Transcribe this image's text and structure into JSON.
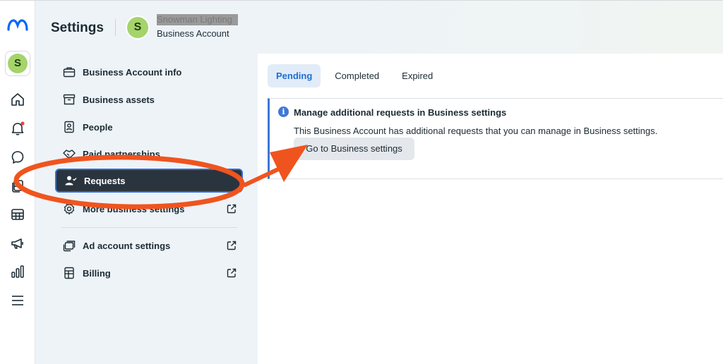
{
  "rail": {
    "avatar_letter": "S",
    "icons": [
      "meta-logo-icon",
      "home-icon",
      "bell-icon",
      "chat-icon",
      "pages-icon",
      "table-icon",
      "megaphone-icon",
      "bar-chart-icon",
      "menu-icon"
    ],
    "notification_dot_color": "#e4473e"
  },
  "header": {
    "title": "Settings",
    "account_avatar_letter": "S",
    "account_name": "Snowman Lighting",
    "account_type": "Business Account"
  },
  "sidebar": {
    "items": [
      {
        "label": "Business Account info",
        "icon": "briefcase-icon"
      },
      {
        "label": "Business assets",
        "icon": "archive-icon"
      },
      {
        "label": "People",
        "icon": "person-badge-icon"
      },
      {
        "label": "Paid partnerships",
        "icon": "handshake-icon"
      },
      {
        "label": "Requests",
        "icon": "person-check-icon",
        "active": true
      },
      {
        "label": "More business settings",
        "icon": "gear-icon",
        "external": true
      },
      {
        "label": "Ad account settings",
        "icon": "ad-account-icon",
        "external": true
      },
      {
        "label": "Billing",
        "icon": "billing-icon",
        "external": true
      }
    ]
  },
  "tabs": [
    {
      "label": "Pending",
      "active": true
    },
    {
      "label": "Completed"
    },
    {
      "label": "Expired"
    }
  ],
  "notice": {
    "icon": "info-icon",
    "icon_glyph": "i",
    "title": "Manage additional requests in Business settings",
    "body": "This Business Account has additional requests that you can manage in Business settings.",
    "button": "Go to Business settings"
  },
  "colors": {
    "accent": "#1b6ed3",
    "annotation": "#f0541e",
    "active_item_bg": "#2a343e"
  }
}
